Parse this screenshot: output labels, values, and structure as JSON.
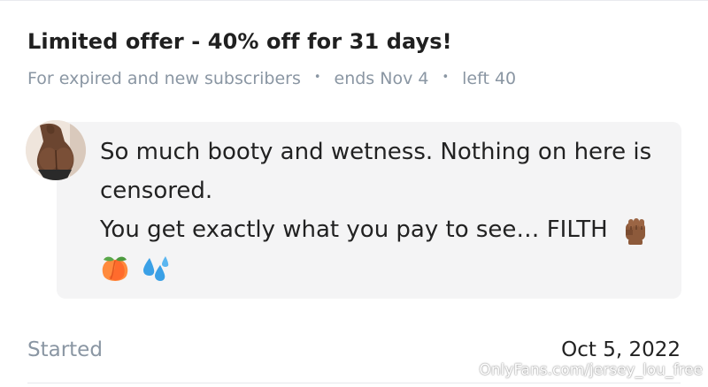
{
  "offer": {
    "title": "Limited offer - 40% off for 31 days!",
    "audience": "For expired and new subscribers",
    "ends": "ends Nov 4",
    "left": "left 40",
    "separator": "•"
  },
  "message": {
    "line1": "So much booty and wetness. Nothing on here is",
    "line2": "censored.",
    "line3": "You get exactly what you pay to see… FILTH",
    "emojis": [
      "raised-fist-icon",
      "peach-icon",
      "sweat-droplets-icon"
    ]
  },
  "subscription": {
    "started_label": "Started",
    "started_date": "Oct 5, 2022"
  },
  "watermark": "OnlyFans.com/jersey_lou_free",
  "colors": {
    "muted_text": "#8a96a3",
    "bubble_bg": "#f4f4f5",
    "text": "#222222"
  }
}
